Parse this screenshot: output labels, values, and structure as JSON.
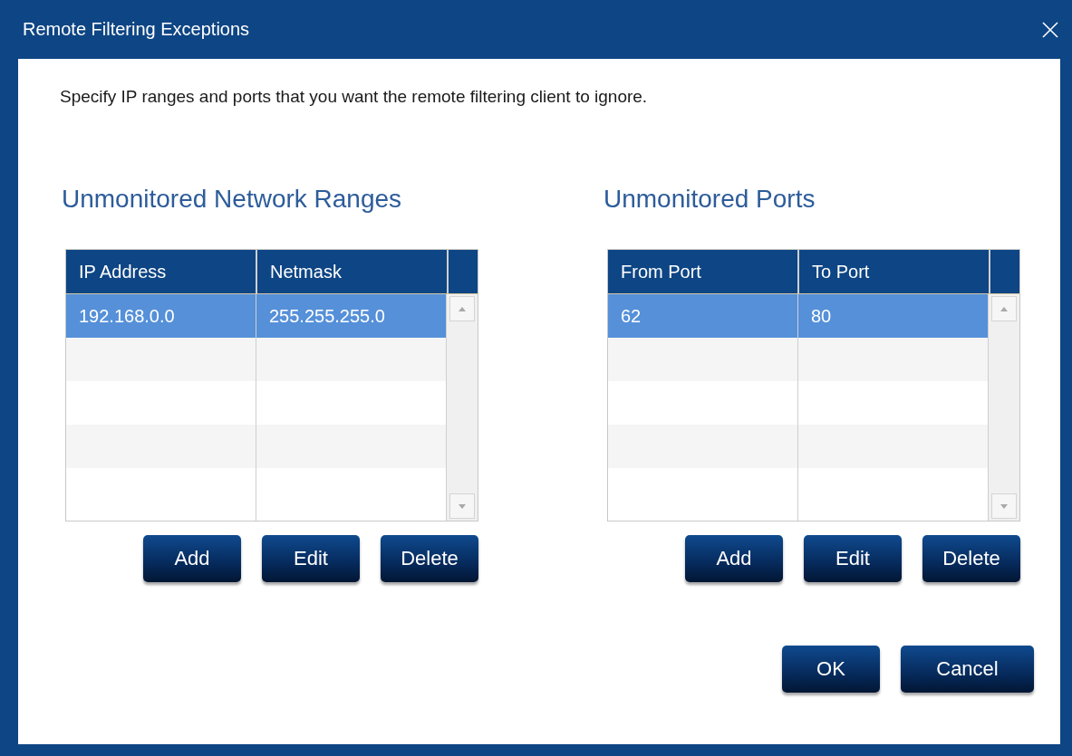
{
  "window": {
    "title": "Remote Filtering Exceptions"
  },
  "description": "Specify IP ranges and ports that you want the remote filtering client to ignore.",
  "panels": [
    {
      "heading": "Unmonitored Network Ranges",
      "columns": [
        "IP Address",
        "Netmask"
      ],
      "rows": [
        {
          "cells": [
            "192.168.0.0",
            "255.255.255.0"
          ],
          "selected": true
        }
      ],
      "buttons": [
        "Add",
        "Edit",
        "Delete"
      ]
    },
    {
      "heading": "Unmonitored Ports",
      "columns": [
        "From Port",
        "To Port"
      ],
      "rows": [
        {
          "cells": [
            "62",
            "80"
          ],
          "selected": true
        }
      ],
      "buttons": [
        "Add",
        "Edit",
        "Delete"
      ]
    }
  ],
  "buttons": [
    "OK",
    "Cancel"
  ]
}
